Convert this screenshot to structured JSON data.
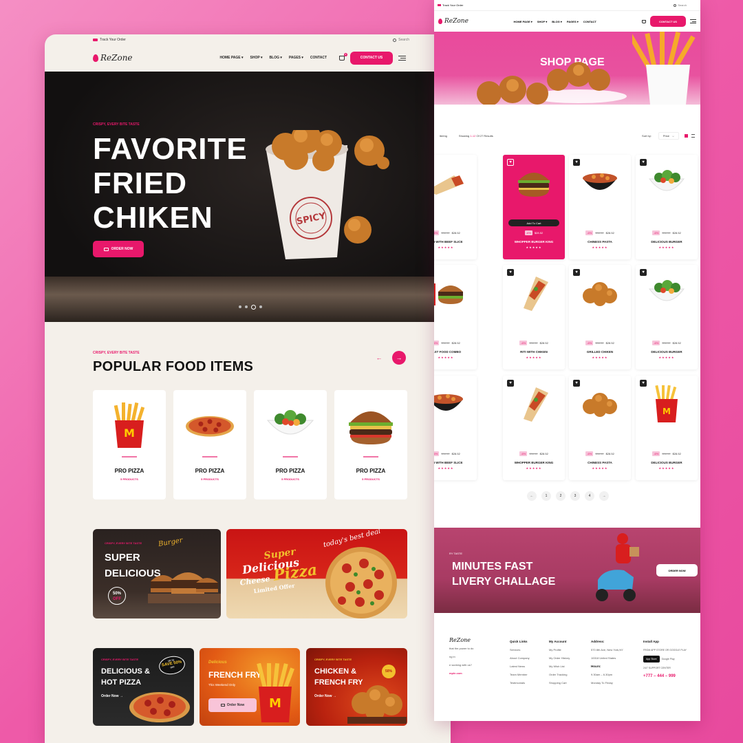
{
  "left": {
    "topbar": {
      "track": "Track Your Order",
      "search": "Search"
    },
    "logo": "ReZone",
    "menu": [
      "HOME PAGE ▾",
      "SHOP ▾",
      "BLOG ▾",
      "PAGES ▾",
      "CONTACT"
    ],
    "cart_count": "0",
    "contact_btn": "CONTACT US",
    "hero": {
      "tag": "CRISPY, EVERY BITE TASTE",
      "title_l1": "FAVORITE",
      "title_l2": "FRIED",
      "title_l3": "CHIKEN",
      "order": "ORDER NOW",
      "bucket_text": "SPICY",
      "bucket_ring": "NEW ARRIVE · DELIVERY 24/H"
    },
    "popular": {
      "tag": "CRISPY, EVERY BITE TASTE",
      "title": "POPULAR FOOD ITEMS",
      "items": [
        {
          "name": "PRO PIZZA",
          "count": "5 PRODUCTS",
          "icon": "fries-icon"
        },
        {
          "name": "PRO PIZZA",
          "count": "5 PRODUCTS",
          "icon": "pizza-icon"
        },
        {
          "name": "PRO PIZZA",
          "count": "5 PRODUCTS",
          "icon": "salad-icon"
        },
        {
          "name": "PRO PIZZA",
          "count": "5 PRODUCTS",
          "icon": "burger-icon"
        }
      ]
    },
    "promo1": {
      "tag": "CRISPY, EVERY BITE TASTE",
      "l1": "SUPER",
      "l2": "DELICIOUS",
      "script": "Burger",
      "badge1": "50%",
      "badge2": "OFF"
    },
    "promo2": {
      "deal": "today's best deal",
      "l1": "Super",
      "l2": "Delicious",
      "l3": "Cheese",
      "l4": "Pizza",
      "l5": "Limited Offer"
    },
    "promo3": {
      "tag": "CRISPY, EVERY BITE TASTE",
      "l1": "DELICIOUS &",
      "l2": "HOT PIZZA",
      "order": "Order Now",
      "badge1": "UP TO",
      "badge2": "SAVE 50%",
      "badge3": "OFF"
    },
    "promo4": {
      "tag": "Delicious",
      "title": "FRENCH FRY",
      "sub": "This Weekend Only",
      "order": "Order Now"
    },
    "promo5": {
      "tag": "CRISPY, EVERY BITE TASTE",
      "l1": "CHICKEN &",
      "l2": "FRENCH FRY",
      "order": "Order Now",
      "badge": "50%"
    }
  },
  "right": {
    "topbar": {
      "track": "Track Your Order",
      "search": "Search"
    },
    "logo": "ReZone",
    "menu": [
      "HOME PAGE ▾",
      "SHOP ▾",
      "BLOG ▾",
      "PAGES ▾",
      "CONTACT"
    ],
    "contact_btn": "CONTACT US",
    "hero_title": "SHOP PAGE",
    "toolbar": {
      "filter": "ltering",
      "showing_pre": "Showing",
      "showing_range": "1-12",
      "showing_post": "Of 27 Results",
      "sortby": "Sort by:",
      "sort_value": "Price",
      "chev": "⌵"
    },
    "products": [
      {
        "name": "RITI WITH BEEF SLICE",
        "disc": "-6%",
        "old": "$38.52",
        "new": "$28.52",
        "icon": "wrap-icon"
      },
      {
        "name": "WHOPPER BURGER KING",
        "disc": "-6%",
        "old": "",
        "new": "$28.52",
        "icon": "burger-icon",
        "add": "Add To Cart"
      },
      {
        "name": "CHINESS PASTA",
        "disc": "-6%",
        "old": "$38.52",
        "new": "$28.52",
        "icon": "pasta-icon"
      },
      {
        "name": "DELICIOUS BURGER",
        "disc": "-6%",
        "old": "$38.52",
        "new": "$28.52",
        "icon": "salad-icon"
      },
      {
        "name": "FAST FOOD COMBO",
        "disc": "-6%",
        "old": "$38.52",
        "new": "$28.52",
        "icon": "combo-icon"
      },
      {
        "name": "RITI WITH CHIKEN",
        "disc": "-6%",
        "old": "$38.52",
        "new": "$28.52",
        "icon": "taco-icon"
      },
      {
        "name": "GRILLED CHIKEN",
        "disc": "-6%",
        "old": "$38.52",
        "new": "$28.52",
        "icon": "chicken-icon"
      },
      {
        "name": "DELICIOUS BURGER",
        "disc": "-6%",
        "old": "$38.52",
        "new": "$28.52",
        "icon": "salad-icon"
      },
      {
        "name": "RITI WITH BEEF SLICE",
        "disc": "-6%",
        "old": "$38.52",
        "new": "$28.52",
        "icon": "pasta-icon"
      },
      {
        "name": "WHOPPER BURGER KING",
        "disc": "-6%",
        "old": "$38.52",
        "new": "$28.52",
        "icon": "taco-icon"
      },
      {
        "name": "CHINESS PASTA",
        "disc": "-6%",
        "old": "$38.52",
        "new": "$28.52",
        "icon": "chicken-icon"
      },
      {
        "name": "DELICIOUS BURGER",
        "disc": "-6%",
        "old": "$38.52",
        "new": "$28.52",
        "icon": "fries-icon"
      }
    ],
    "pages": [
      "←",
      "1",
      "2",
      "3",
      "4",
      "→"
    ],
    "banner": {
      "tag": "RY TASTE",
      "l1": "MINUTES FAST",
      "l2_pre": "LIVERY",
      "l2_post": "CHALLAGE",
      "order": "ORDER NOW"
    },
    "footer": {
      "logo": "ReZone",
      "about": [
        "that the power to do",
        "ng in",
        "e working with us?",
        "mple.com"
      ],
      "quick_title": "Quick Links",
      "quick": [
        "Services",
        "About Company",
        "Latest News",
        "Team Member",
        "Testimonials"
      ],
      "account_title": "My Account",
      "account": [
        "My Profile",
        "My Order History",
        "My Wish List",
        "Order Tracking",
        "Shopping Cart"
      ],
      "address_title": "Address:",
      "address": [
        "570 8th Ave, New York,NY",
        "10018 United States"
      ],
      "hours_title": "Hours:",
      "hours": [
        "9.30am – 6.30pm",
        "Monday To Friday"
      ],
      "install_title": "Install App",
      "install_sub": "FROM APP STORE OR GOOGLE PLAY",
      "appstore": "App Store",
      "gplay": "Google Play",
      "support": "24/7 SUPPORT CENTER",
      "phone": "+777 – 444 – 999"
    }
  },
  "colors": {
    "accent": "#e8186b",
    "bg_left": "#f4f0ea",
    "bg_page": "#ee5aa8"
  }
}
